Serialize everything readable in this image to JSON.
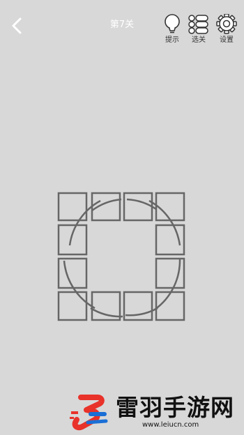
{
  "header": {
    "level_title": "第7关",
    "hint_label": "提示",
    "levels_label": "选关",
    "settings_label": "设置"
  },
  "puzzle": {
    "tile_color": "#666666"
  },
  "watermark": {
    "name": "雷羽手游网",
    "url": "www.leiucn.com",
    "accent_color": "#e8322a",
    "secondary_color": "#1a6fd6"
  }
}
